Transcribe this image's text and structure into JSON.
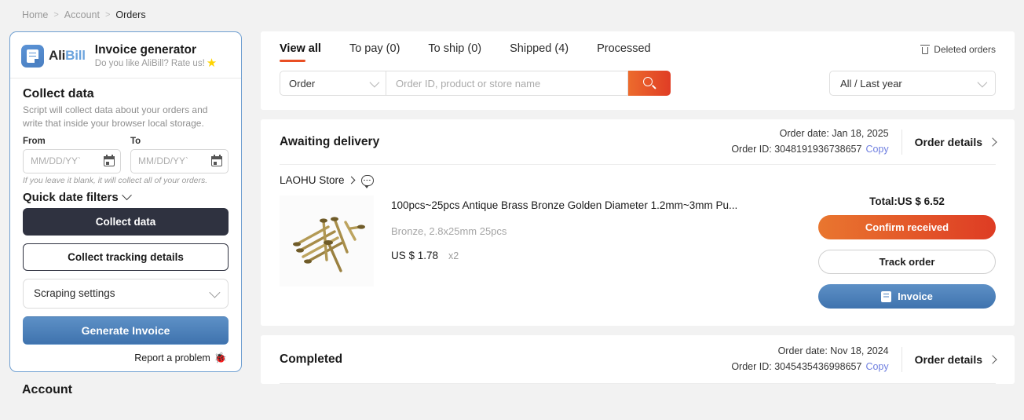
{
  "breadcrumb": {
    "items": [
      "Home",
      "Account",
      "Orders"
    ],
    "separator": ">"
  },
  "sidebar": {
    "logo": {
      "ali": "Ali",
      "bill": "Bill",
      "icon": "alibill-logo-icon"
    },
    "title": "Invoice generator",
    "subtitle": "Do you like AliBill? Rate us!",
    "star_icon": "star-icon",
    "collect": {
      "title": "Collect data",
      "description": "Script will collect data about your orders and write that inside your browser local storage.",
      "from_label": "From",
      "to_label": "To",
      "date_placeholder": "MM/DD/YY`",
      "hint": "If you leave it blank, it will collect all of your orders."
    },
    "quick_filters_label": "Quick date filters",
    "collect_data_button": "Collect data",
    "collect_tracking_button": "Collect tracking details",
    "scraping_settings": "Scraping settings",
    "generate_invoice_button": "Generate Invoice",
    "report_problem": "Report a problem",
    "bug_icon": "🐞",
    "account_title": "Account"
  },
  "toolbar": {
    "tabs": [
      {
        "label": "View all",
        "active": true
      },
      {
        "label": "To pay (0)",
        "active": false
      },
      {
        "label": "To ship (0)",
        "active": false
      },
      {
        "label": "Shipped (4)",
        "active": false
      },
      {
        "label": "Processed",
        "active": false
      }
    ],
    "deleted_orders": "Deleted orders",
    "search_scope": "Order",
    "search_value": "",
    "search_placeholder": "Order ID, product or store name",
    "date_filter": "All / Last year"
  },
  "orders": [
    {
      "status": "Awaiting delivery",
      "order_date_label": "Order date: Jan 18, 2025",
      "order_id_label": "Order ID: 3048191936738657",
      "copy_label": "Copy",
      "details_label": "Order details",
      "store_name": "LAOHU Store",
      "item": {
        "title": "100pcs~25pcs Antique Brass Bronze Golden Diameter 1.2mm~3mm Pu...",
        "variant": "Bronze, 2.8x25mm 25pcs",
        "price": "US $ 1.78",
        "qty": "x2"
      },
      "total": "Total:US $ 6.52",
      "actions": {
        "confirm": "Confirm received",
        "track": "Track order",
        "invoice": "Invoice"
      }
    },
    {
      "status": "Completed",
      "order_date_label": "Order date: Nov 18, 2024",
      "order_id_label": "Order ID: 3045435436998657",
      "copy_label": "Copy",
      "details_label": "Order details"
    }
  ],
  "colors": {
    "accent_orange": "#e94f24",
    "brand_blue": "#4a7fc1",
    "copy_link": "#6f7fe0",
    "dark_button": "#2f3240"
  }
}
